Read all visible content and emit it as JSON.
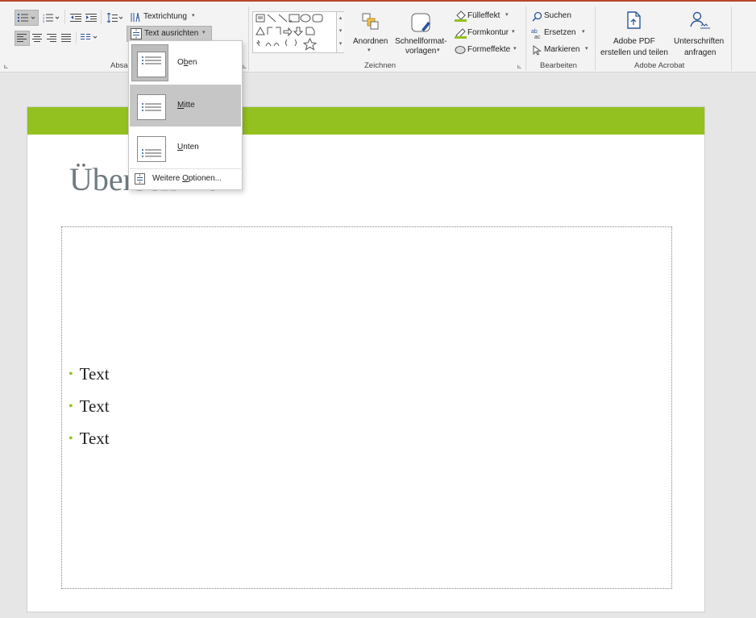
{
  "ribbon": {
    "absatz": {
      "group_label": "Absa",
      "textrichtung": "Textrichtung",
      "text_ausrichten": "Text ausrichten"
    },
    "zeichnen": {
      "group_label": "Zeichnen",
      "anordnen": "Anordnen",
      "schnellformat_line1": "Schnellformat-",
      "schnellformat_line2": "vorlagen",
      "fuelleffekt": "Fülleffekt",
      "formkontur": "Formkontur",
      "formeffekte": "Formeffekte"
    },
    "bearbeiten": {
      "group_label": "Bearbeiten",
      "suchen": "Suchen",
      "ersetzen": "Ersetzen",
      "markieren": "Markieren"
    },
    "acrobat": {
      "group_label": "Adobe Acrobat",
      "pdf_line1": "Adobe PDF",
      "pdf_line2": "erstellen und teilen",
      "sign_line1": "Unterschriften",
      "sign_line2": "anfragen"
    },
    "accent_color": "#b7472a"
  },
  "dropdown": {
    "items": [
      {
        "label_pre": "O",
        "label_u": "b",
        "label_post": "en",
        "state": "selected"
      },
      {
        "label_pre": "",
        "label_u": "M",
        "label_post": "itte",
        "state": "hovered"
      },
      {
        "label_pre": "",
        "label_u": "U",
        "label_post": "nten",
        "state": "normal"
      }
    ],
    "more_pre": "Weitere ",
    "more_u": "O",
    "more_post": "ptionen..."
  },
  "slide": {
    "title": "Überschrift",
    "bullets": [
      "Text",
      "Text",
      "Text"
    ],
    "band_color": "#93c11f"
  }
}
